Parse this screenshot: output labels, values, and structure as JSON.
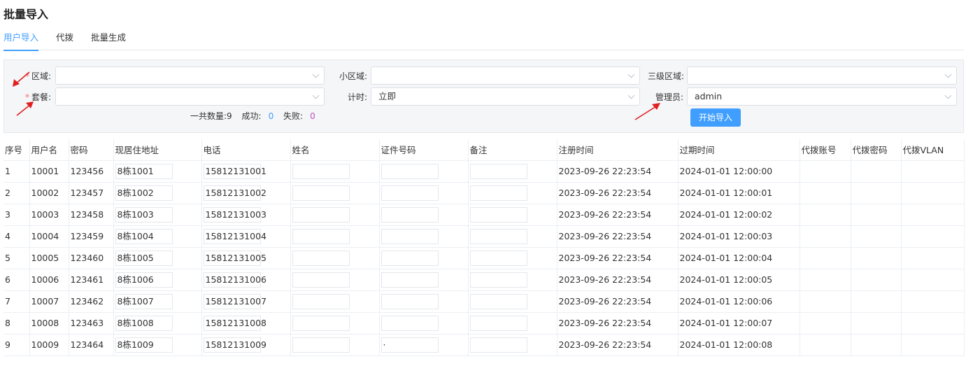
{
  "page": {
    "title": "批量导入"
  },
  "tabs": [
    {
      "label": "用户导入",
      "active": true
    },
    {
      "label": "代拨",
      "active": false
    },
    {
      "label": "批量生成",
      "active": false
    }
  ],
  "form": {
    "region": {
      "label": "区域:",
      "value": ""
    },
    "subregion": {
      "label": "小区域:",
      "value": ""
    },
    "region3": {
      "label": "三级区域:",
      "value": ""
    },
    "package": {
      "label": "套餐:",
      "value": ""
    },
    "timing": {
      "label": "计时:",
      "value": "立即"
    },
    "admin": {
      "label": "管理员:",
      "value": "admin"
    },
    "required_mark": "*"
  },
  "stats": {
    "total_label": "一共数量:9",
    "success_label": "成功:",
    "success_value": "0",
    "fail_label": "失败:",
    "fail_value": "0"
  },
  "actions": {
    "import_label": "开始导入"
  },
  "colors": {
    "accent": "#409eff",
    "required": "#f56c6c",
    "arrow": "#e02020",
    "fail": "#c050c0"
  },
  "table": {
    "headers": [
      "序号",
      "用户名",
      "密码",
      "现居住地址",
      "电话",
      "姓名",
      "证件号码",
      "备注",
      "注册时间",
      "过期时间",
      "代拨账号",
      "代拨密码",
      "代拨VLAN"
    ],
    "rows": [
      {
        "no": "1",
        "user": "10001",
        "pwd": "123456",
        "addr": "8栋1001",
        "phone": "15812131001",
        "name": "",
        "id": "",
        "note": "",
        "reg": "2023-09-26 22:23:54",
        "exp": "2024-01-01 12:00:00"
      },
      {
        "no": "2",
        "user": "10002",
        "pwd": "123457",
        "addr": "8栋1002",
        "phone": "15812131002",
        "name": "",
        "id": "",
        "note": "",
        "reg": "2023-09-26 22:23:54",
        "exp": "2024-01-01 12:00:01"
      },
      {
        "no": "3",
        "user": "10003",
        "pwd": "123458",
        "addr": "8栋1003",
        "phone": "15812131003",
        "name": "",
        "id": "",
        "note": "",
        "reg": "2023-09-26 22:23:54",
        "exp": "2024-01-01 12:00:02"
      },
      {
        "no": "4",
        "user": "10004",
        "pwd": "123459",
        "addr": "8栋1004",
        "phone": "15812131004",
        "name": "",
        "id": "",
        "note": "",
        "reg": "2023-09-26 22:23:54",
        "exp": "2024-01-01 12:00:03"
      },
      {
        "no": "5",
        "user": "10005",
        "pwd": "123460",
        "addr": "8栋1005",
        "phone": "15812131005",
        "name": "",
        "id": "",
        "note": "",
        "reg": "2023-09-26 22:23:54",
        "exp": "2024-01-01 12:00:04"
      },
      {
        "no": "6",
        "user": "10006",
        "pwd": "123461",
        "addr": "8栋1006",
        "phone": "15812131006",
        "name": "",
        "id": "",
        "note": "",
        "reg": "2023-09-26 22:23:54",
        "exp": "2024-01-01 12:00:05"
      },
      {
        "no": "7",
        "user": "10007",
        "pwd": "123462",
        "addr": "8栋1007",
        "phone": "15812131007",
        "name": "",
        "id": "",
        "note": "",
        "reg": "2023-09-26 22:23:54",
        "exp": "2024-01-01 12:00:06"
      },
      {
        "no": "8",
        "user": "10008",
        "pwd": "123463",
        "addr": "8栋1008",
        "phone": "15812131008",
        "name": "",
        "id": "",
        "note": "",
        "reg": "2023-09-26 22:23:54",
        "exp": "2024-01-01 12:00:07"
      },
      {
        "no": "9",
        "user": "10009",
        "pwd": "123464",
        "addr": "8栋1009",
        "phone": "15812131009",
        "name": "",
        "id": "·",
        "note": "",
        "reg": "2023-09-26 22:23:54",
        "exp": "2024-01-01 12:00:08"
      }
    ]
  }
}
